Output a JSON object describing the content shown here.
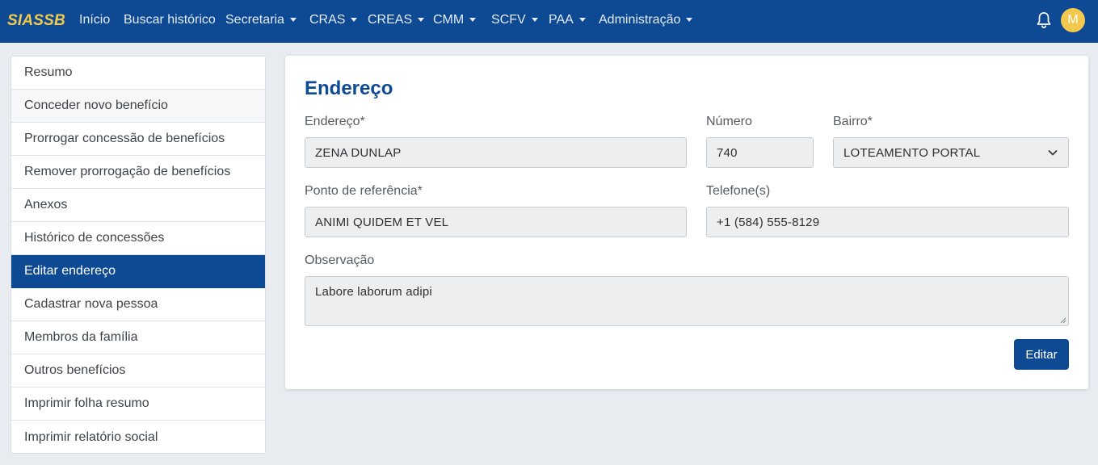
{
  "navbar": {
    "brand": "SIASSB",
    "items": [
      {
        "label": "Início",
        "dropdown": false
      },
      {
        "label": "Buscar histórico",
        "dropdown": false
      },
      {
        "label": "Secretaria",
        "dropdown": true
      },
      {
        "label": "CRAS",
        "dropdown": true
      },
      {
        "label": "CREAS",
        "dropdown": true
      },
      {
        "label": "CMM",
        "dropdown": true
      },
      {
        "label": "SCFV",
        "dropdown": true
      },
      {
        "label": "PAA",
        "dropdown": true
      },
      {
        "label": "Administração",
        "dropdown": true
      }
    ],
    "notification_icon": "bell-icon",
    "avatar_initial": "M"
  },
  "sidebar": {
    "items": [
      {
        "label": "Resumo"
      },
      {
        "label": "Conceder novo benefício"
      },
      {
        "label": "Prorrogar concessão de benefícios"
      },
      {
        "label": "Remover prorrogação de benefícios"
      },
      {
        "label": "Anexos"
      },
      {
        "label": "Histórico de concessões"
      },
      {
        "label": "Editar endereço"
      },
      {
        "label": "Cadastrar nova pessoa"
      },
      {
        "label": "Membros da família"
      },
      {
        "label": "Outros benefícios"
      },
      {
        "label": "Imprimir folha resumo"
      },
      {
        "label": "Imprimir relatório social"
      }
    ],
    "active_index": 6
  },
  "form": {
    "title": "Endereço",
    "endereco_label": "Endereço*",
    "endereco_value": "ZENA DUNLAP",
    "numero_label": "Número",
    "numero_value": "740",
    "bairro_label": "Bairro*",
    "bairro_value": "LOTEAMENTO PORTAL",
    "referencia_label": "Ponto de referência*",
    "referencia_value": "ANIMI QUIDEM ET VEL",
    "telefone_label": "Telefone(s)",
    "telefone_value": "+1 (584) 555-8129",
    "observacao_label": "Observação",
    "observacao_value": "Labore laborum adipi",
    "submit_label": "Editar"
  },
  "colors": {
    "primary": "#0d4a93",
    "brand_yellow": "#f2c94c",
    "page_background": "#e8ebef"
  }
}
